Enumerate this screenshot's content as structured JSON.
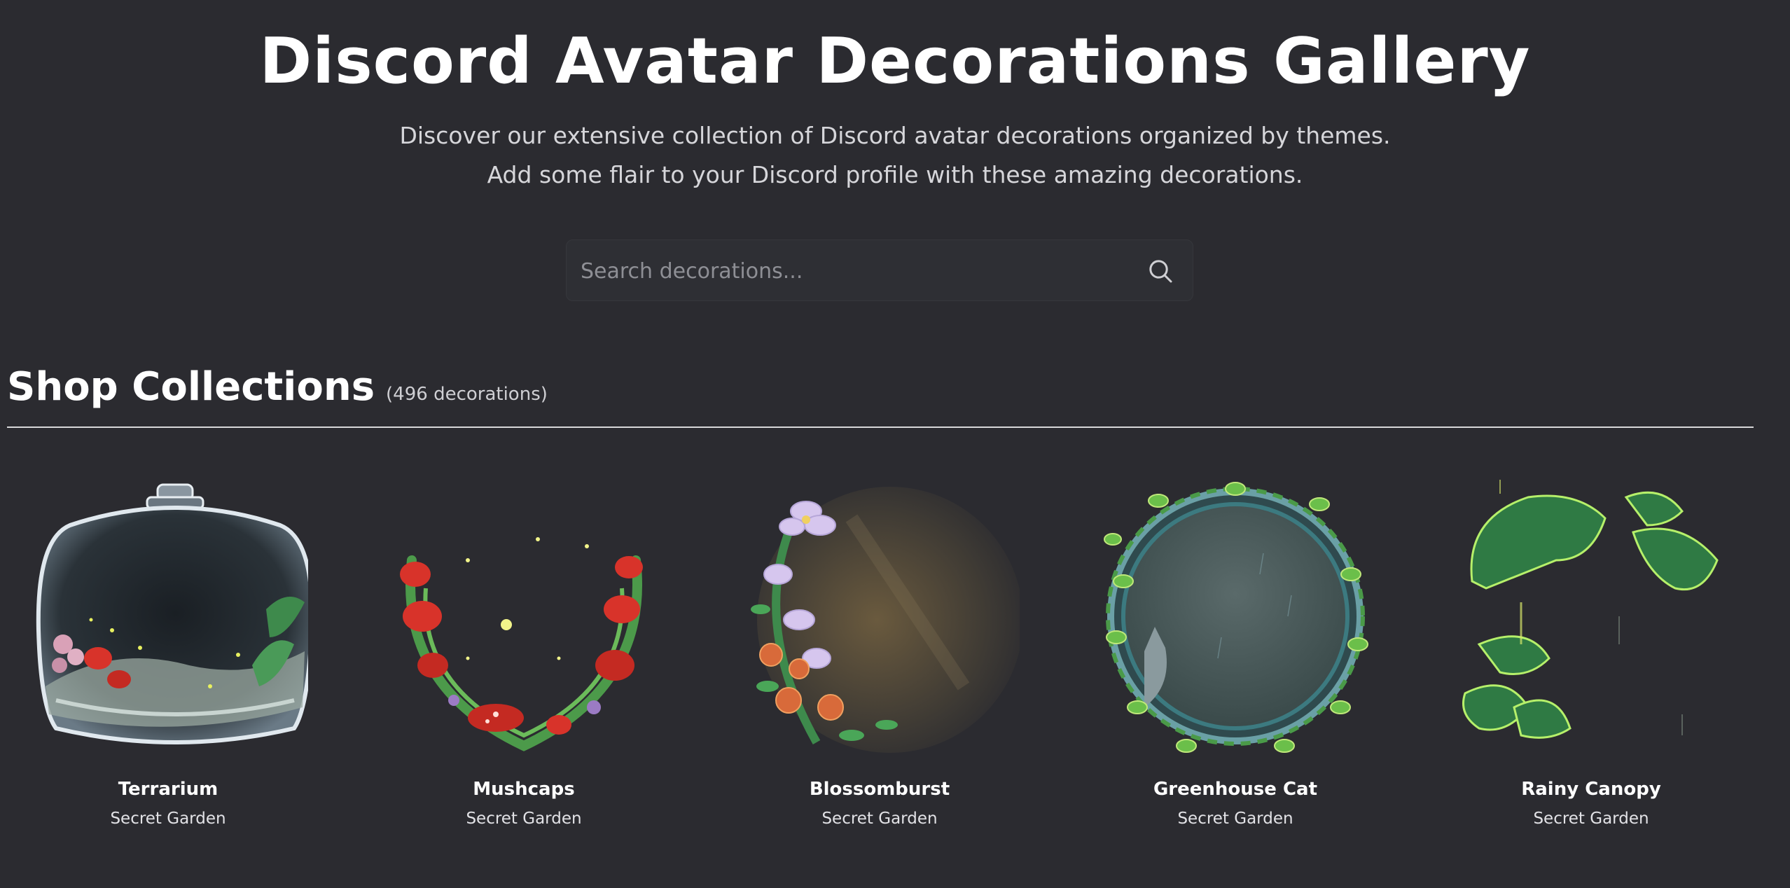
{
  "header": {
    "title": "Discord Avatar Decorations Gallery",
    "subtitle_line1": "Discover our extensive collection of Discord avatar decorations organized by themes.",
    "subtitle_line2": "Add some flair to your Discord profile with these amazing decorations."
  },
  "search": {
    "placeholder": "Search decorations...",
    "value": "",
    "icon": "search-icon"
  },
  "section": {
    "title": "Shop Collections",
    "count": "(496 decorations)"
  },
  "decorations": [
    {
      "name": "Terrarium",
      "collection": "Secret Garden",
      "icon": "terrarium-decoration-icon"
    },
    {
      "name": "Mushcaps",
      "collection": "Secret Garden",
      "icon": "mushroom-wreath-decoration-icon"
    },
    {
      "name": "Blossomburst",
      "collection": "Secret Garden",
      "icon": "flower-frame-decoration-icon"
    },
    {
      "name": "Greenhouse Cat",
      "collection": "Secret Garden",
      "icon": "vine-ring-cat-decoration-icon"
    },
    {
      "name": "Rainy Canopy",
      "collection": "Secret Garden",
      "icon": "leaf-canopy-decoration-icon"
    }
  ],
  "colors": {
    "background": "#2b2b30",
    "text": "#ffffff",
    "muted_text": "#d6d6da",
    "divider": "#d8d8da"
  }
}
